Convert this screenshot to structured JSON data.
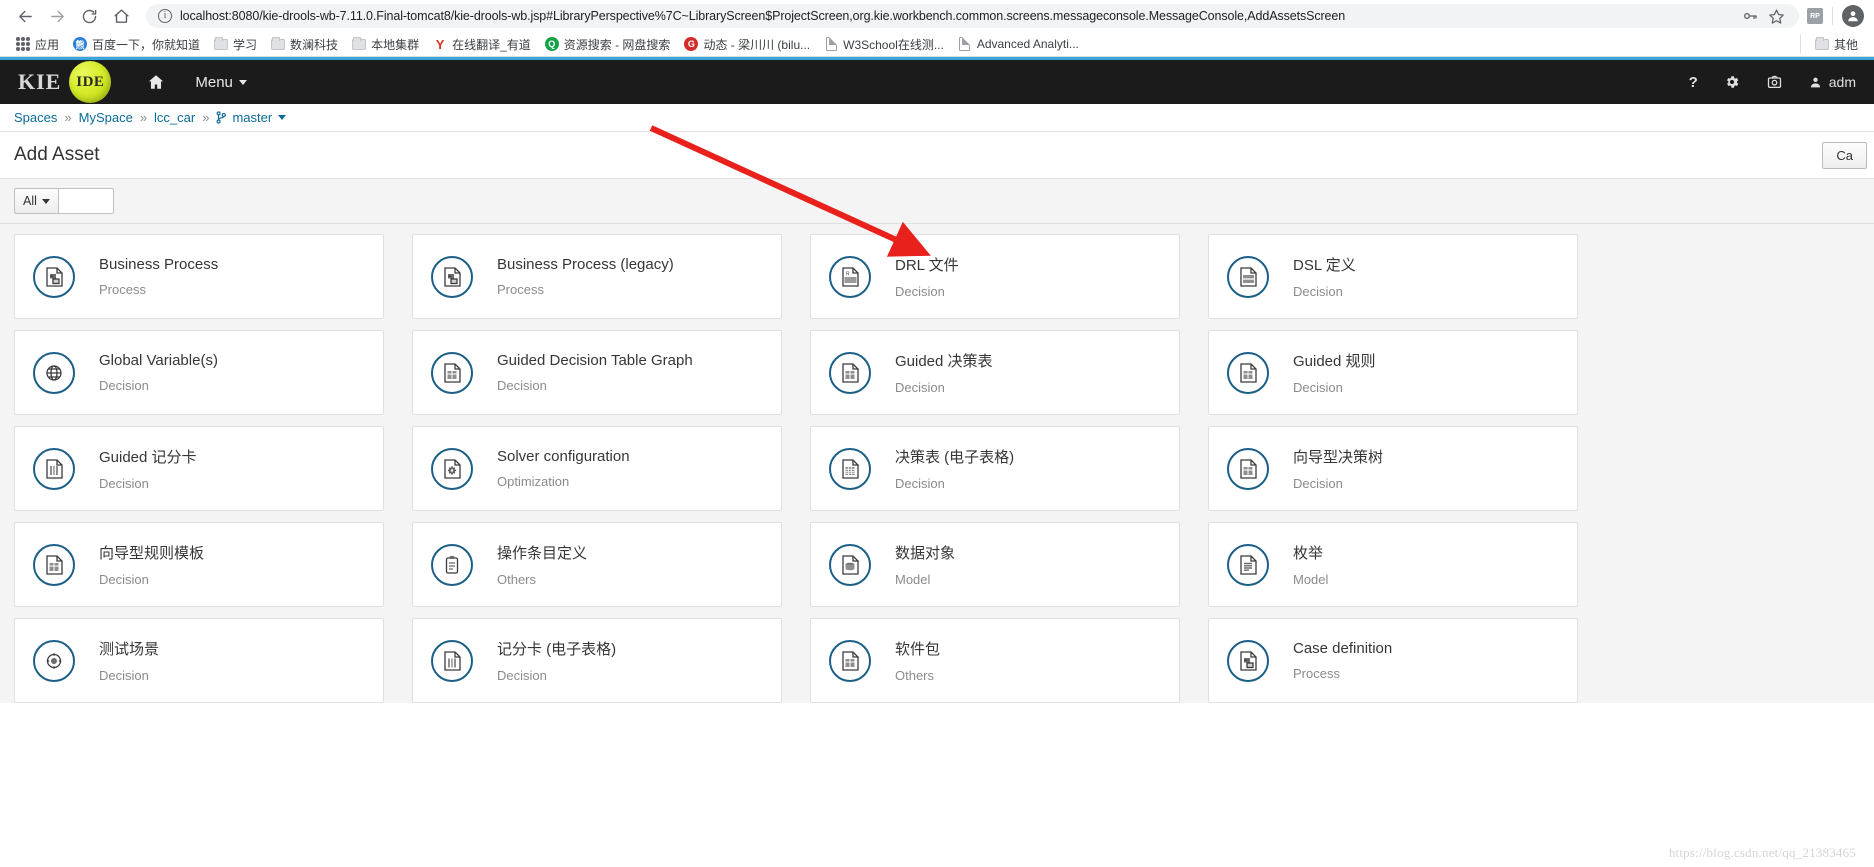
{
  "browser": {
    "back_icon": "back-arrow-icon",
    "forward_icon": "forward-arrow-icon",
    "reload_icon": "reload-icon",
    "home_icon": "home-icon",
    "url": "localhost:8080/kie-drools-wb-7.11.0.Final-tomcat8/kie-drools-wb.jsp#LibraryPerspective%7C~LibraryScreen$ProjectScreen,org.kie.workbench.common.screens.messageconsole.MessageConsole,AddAssetsScreen",
    "key_icon": "key-icon",
    "star_icon": "star-icon",
    "extension_badge": "RP",
    "profile_icon": "profile-avatar-icon",
    "bookmarks": [
      {
        "label": "应用",
        "icon": "apps-grid-icon",
        "type": "apps"
      },
      {
        "label": "百度一下，你就知道",
        "icon": "baidu-favicon",
        "type": "circle",
        "color": "#2b7fd4",
        "glyph": "熊"
      },
      {
        "label": "学习",
        "icon": "folder-icon",
        "type": "folder"
      },
      {
        "label": "数澜科技",
        "icon": "folder-icon",
        "type": "folder"
      },
      {
        "label": "本地集群",
        "icon": "folder-icon",
        "type": "folder"
      },
      {
        "label": "在线翻译_有道",
        "icon": "youdao-favicon",
        "type": "letter",
        "color": "#d93025",
        "glyph": "Y"
      },
      {
        "label": "资源搜索 - 网盘搜索",
        "icon": "search-favicon",
        "type": "circle",
        "color": "#16a34a",
        "glyph": "Q"
      },
      {
        "label": "动态 - 梁川川 (bilu...",
        "icon": "bilibili-favicon",
        "type": "circle",
        "color": "#d42b2b",
        "glyph": "G"
      },
      {
        "label": "W3School在线测...",
        "icon": "document-favicon",
        "type": "doc"
      },
      {
        "label": "Advanced Analyti...",
        "icon": "document-favicon",
        "type": "doc"
      }
    ],
    "other_bookmarks": {
      "label": "其他",
      "icon": "folder-icon"
    }
  },
  "app": {
    "logo": {
      "kie": "KIE",
      "ide": "IDE"
    },
    "home_icon": "home-icon",
    "menu_label": "Menu",
    "menu_caret_icon": "chevron-down-icon",
    "right_icons": {
      "help": "question-mark-icon",
      "settings": "gear-icon",
      "camera": "camera-icon",
      "user_icon": "user-icon",
      "user_name": "adm"
    }
  },
  "breadcrumb": {
    "items": [
      {
        "label": "Spaces"
      },
      {
        "label": "MySpace"
      },
      {
        "label": "lcc_car"
      }
    ],
    "separator": "»",
    "branch": {
      "label": "master",
      "icon": "branch-icon",
      "caret": "chevron-down-icon"
    }
  },
  "page": {
    "title": "Add Asset",
    "cancel_label": "Ca"
  },
  "filter": {
    "dropdown_label": "All",
    "dropdown_caret": "chevron-down-icon",
    "search_value": "",
    "search_placeholder": ""
  },
  "assets": [
    [
      {
        "title": "Business Process",
        "category": "Process",
        "icon": "process-diagram-icon"
      },
      {
        "title": "Business Process (legacy)",
        "category": "Process",
        "icon": "process-diagram-icon"
      },
      {
        "title": "DRL 文件",
        "category": "Decision",
        "icon": "drl-rule-file-icon"
      },
      {
        "title": "DSL 定义",
        "category": "Decision",
        "icon": "dsl-definition-icon"
      }
    ],
    [
      {
        "title": "Global Variable(s)",
        "category": "Decision",
        "icon": "global-variable-icon"
      },
      {
        "title": "Guided Decision Table Graph",
        "category": "Decision",
        "icon": "decision-table-graph-icon"
      },
      {
        "title": "Guided 决策表",
        "category": "Decision",
        "icon": "guided-decision-table-icon"
      },
      {
        "title": "Guided 规则",
        "category": "Decision",
        "icon": "guided-rule-icon"
      }
    ],
    [
      {
        "title": "Guided 记分卡",
        "category": "Decision",
        "icon": "scorecard-icon"
      },
      {
        "title": "Solver configuration",
        "category": "Optimization",
        "icon": "solver-gear-icon"
      },
      {
        "title": "决策表 (电子表格)",
        "category": "Decision",
        "icon": "spreadsheet-decision-table-icon"
      },
      {
        "title": "向导型决策树",
        "category": "Decision",
        "icon": "decision-tree-icon"
      }
    ],
    [
      {
        "title": "向导型规则模板",
        "category": "Decision",
        "icon": "rule-template-icon"
      },
      {
        "title": "操作条目定义",
        "category": "Others",
        "icon": "work-item-definition-icon"
      },
      {
        "title": "数据对象",
        "category": "Model",
        "icon": "data-object-icon"
      },
      {
        "title": "枚举",
        "category": "Model",
        "icon": "enumeration-icon"
      }
    ],
    [
      {
        "title": "测试场景",
        "category": "Decision",
        "icon": "test-scenario-icon"
      },
      {
        "title": "记分卡 (电子表格)",
        "category": "Decision",
        "icon": "scorecard-spreadsheet-icon"
      },
      {
        "title": "软件包",
        "category": "Others",
        "icon": "package-icon"
      },
      {
        "title": "Case definition",
        "category": "Process",
        "icon": "case-definition-icon"
      }
    ]
  ],
  "annotation": {
    "arrow_color": "#e8211c",
    "arrow_target": "DRL 文件"
  },
  "watermark": "https://blog.csdn.net/qq_21383465"
}
